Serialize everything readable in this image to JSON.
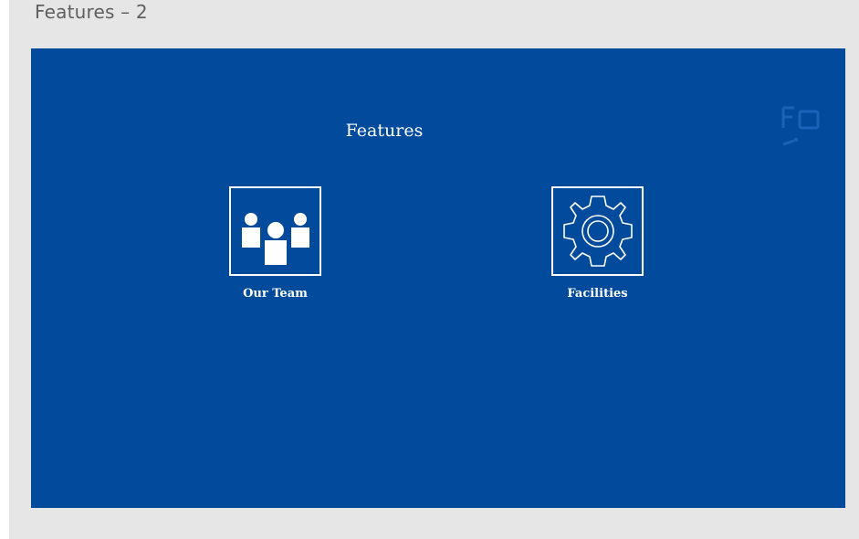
{
  "window": {
    "title": "Features – 2"
  },
  "slide": {
    "heading": "Features",
    "background_color": "#024a9b",
    "items": [
      {
        "label": "Our Team",
        "icon": "team-icon"
      },
      {
        "label": "Facilities",
        "icon": "gear-icon"
      }
    ]
  },
  "colors": {
    "frame_bg": "#e6e6e6",
    "title_text": "#5f5f5f",
    "foreground": "#ffffff"
  }
}
